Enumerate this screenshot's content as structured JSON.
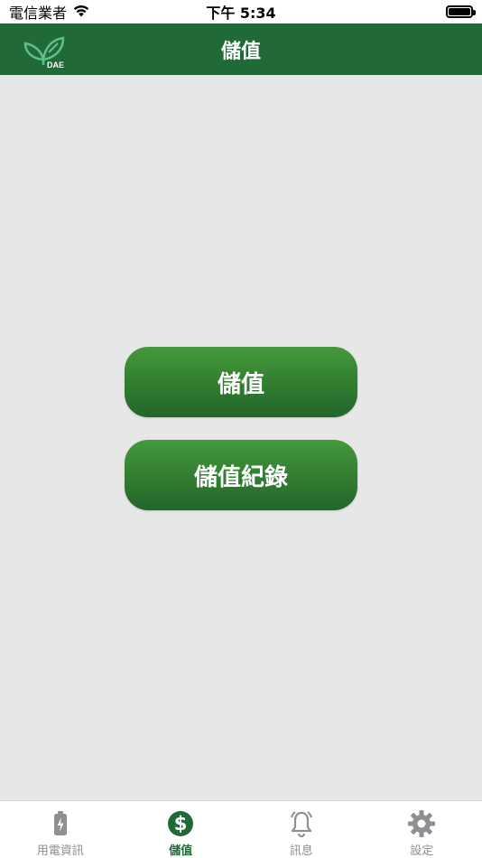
{
  "status_bar": {
    "carrier": "電信業者",
    "time": "下午 5:34",
    "wifi_icon": "wifi-icon",
    "battery_icon": "battery-icon"
  },
  "nav": {
    "title": "儲值",
    "logo_text": "DAE",
    "logo_icon": "leaf-logo-icon"
  },
  "main": {
    "buttons": [
      {
        "label": "儲值"
      },
      {
        "label": "儲值紀錄"
      }
    ]
  },
  "tabs": [
    {
      "label": "用電資訊",
      "icon": "battery-charging-icon",
      "active": false
    },
    {
      "label": "儲值",
      "icon": "dollar-icon",
      "active": true
    },
    {
      "label": "訊息",
      "icon": "bell-icon",
      "active": false
    },
    {
      "label": "設定",
      "icon": "gear-icon",
      "active": false
    }
  ],
  "colors": {
    "brand": "#216a38",
    "button_top": "#45993a",
    "button_bottom": "#23652b",
    "tab_inactive": "#8e8e93",
    "background": "#e7e7e7"
  }
}
